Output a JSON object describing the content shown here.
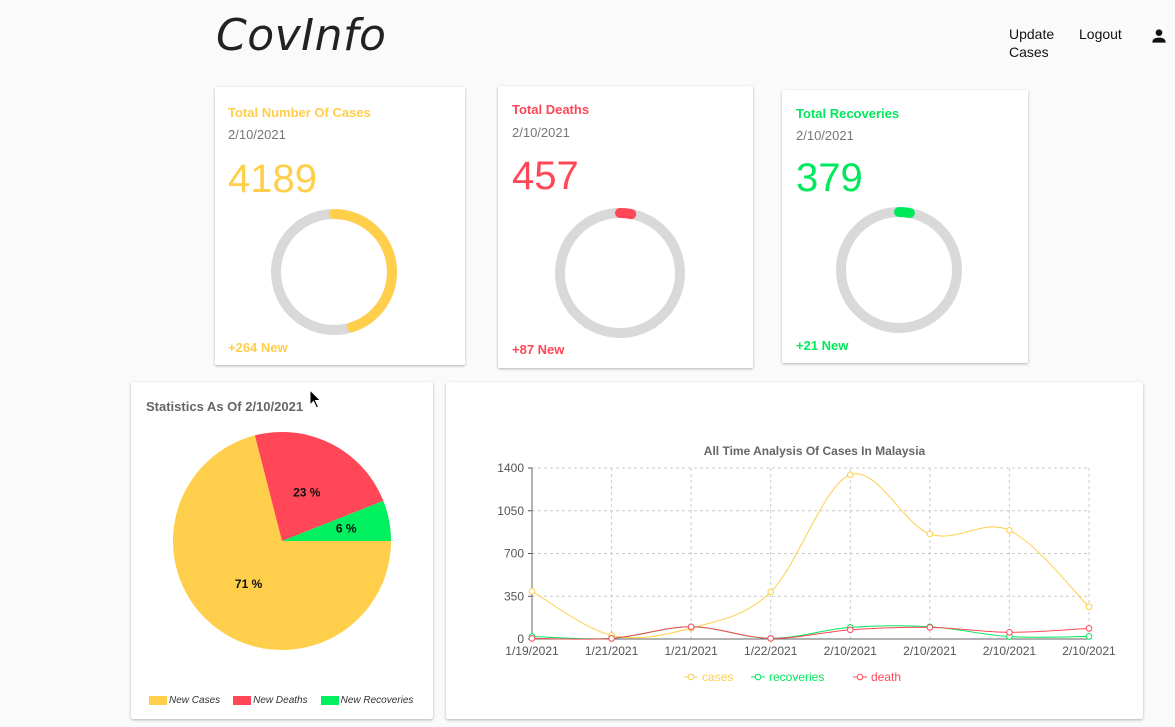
{
  "header": {
    "logo": "CovInfo",
    "nav": {
      "update_line1": "Update",
      "update_line2": "Cases",
      "logout": "Logout"
    },
    "user_icon": "person-icon"
  },
  "cards": [
    {
      "title": "Total Number Of Cases",
      "date": "2/10/2021",
      "value": "4189",
      "new": "+264 New",
      "color": "#ffce4a",
      "fraction": 0.45
    },
    {
      "title": "Total Deaths",
      "date": "2/10/2021",
      "value": "457",
      "new": "+87 New",
      "color": "#ff4757",
      "fraction": 0.03
    },
    {
      "title": "Total Recoveries",
      "date": "2/10/2021",
      "value": "379",
      "new": "+21 New",
      "color": "#00e85c",
      "fraction": 0.03
    }
  ],
  "pie_panel": {
    "title": "Statistics As Of 2/10/2021",
    "legend": [
      "New Cases",
      "New Deaths",
      "New Recoveries"
    ]
  },
  "chart_data": [
    {
      "type": "pie",
      "title": "Statistics As Of 2/10/2021",
      "slices": [
        {
          "name": "New Cases",
          "value": 71,
          "label": "71 %",
          "color": "#ffce4a"
        },
        {
          "name": "New Deaths",
          "value": 23,
          "label": "23 %",
          "color": "#ff4757"
        },
        {
          "name": "New Recoveries",
          "value": 6,
          "label": "6 %",
          "color": "#00f060"
        }
      ],
      "legend_position": "bottom"
    },
    {
      "type": "line",
      "title": "All Time Analysis Of Cases In Malaysia",
      "categories": [
        "1/19/2021",
        "1/21/2021",
        "1/21/2021",
        "1/22/2021",
        "2/10/2021",
        "2/10/2021",
        "2/10/2021",
        "2/10/2021"
      ],
      "ylim": [
        0,
        1400
      ],
      "yticks": [
        "0",
        "350",
        "700",
        "1050",
        "1400"
      ],
      "grid": true,
      "legend_position": "bottom",
      "series": [
        {
          "name": "cases",
          "color": "#ffce4a",
          "values": [
            390,
            30,
            90,
            385,
            1345,
            860,
            890,
            264
          ]
        },
        {
          "name": "recoveries",
          "color": "#00e85c",
          "values": [
            20,
            5,
            100,
            5,
            95,
            100,
            20,
            21
          ]
        },
        {
          "name": "death",
          "color": "#ff4757",
          "values": [
            5,
            5,
            100,
            5,
            75,
            95,
            55,
            87
          ]
        }
      ]
    }
  ]
}
